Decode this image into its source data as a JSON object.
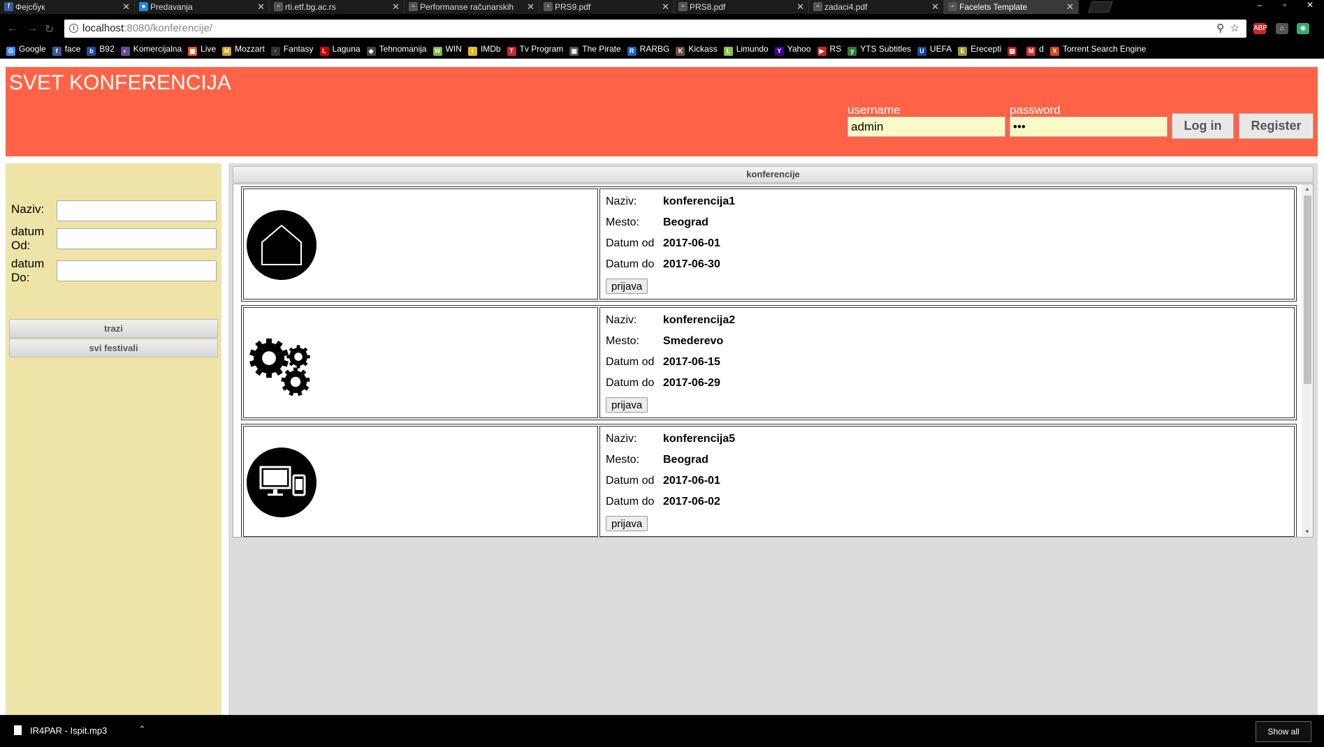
{
  "browser": {
    "tabs": [
      {
        "title": "Фејсбук",
        "icon": "facebook-icon",
        "color": "#3b5998",
        "glyph": "f"
      },
      {
        "title": "Predavanja",
        "icon": "edge-icon",
        "color": "#1e88e5",
        "glyph": "●"
      },
      {
        "title": "rti.etf.bg.ac.rs",
        "icon": "page-icon",
        "color": "#555555",
        "glyph": "▫"
      },
      {
        "title": "Performanse računarskih",
        "icon": "page-icon",
        "color": "#555555",
        "glyph": "▫"
      },
      {
        "title": "PRS9.pdf",
        "icon": "page-icon",
        "color": "#555555",
        "glyph": "▫"
      },
      {
        "title": "PRS8.pdf",
        "icon": "page-icon",
        "color": "#555555",
        "glyph": "▫"
      },
      {
        "title": "zadaci4.pdf",
        "icon": "page-icon",
        "color": "#555555",
        "glyph": "▫"
      },
      {
        "title": "Facelets Template",
        "icon": "page-icon",
        "color": "#555555",
        "glyph": "▫",
        "active": true
      }
    ],
    "url": {
      "host": "localhost",
      "path": ":8080/konferencije/"
    },
    "bookmarks": [
      {
        "label": "Google",
        "color": "#4285f4",
        "glyph": "G"
      },
      {
        "label": "face",
        "color": "#3b5998",
        "glyph": "f"
      },
      {
        "label": "B92",
        "color": "#1d4fa0",
        "glyph": "b"
      },
      {
        "label": "Komercijalna",
        "color": "#6a4c9c",
        "glyph": "◐"
      },
      {
        "label": "Live",
        "color": "#f25022",
        "glyph": "▦"
      },
      {
        "label": "Mozzart",
        "color": "#d4a017",
        "glyph": "M"
      },
      {
        "label": "Fantasy",
        "color": "#333333",
        "glyph": "·"
      },
      {
        "label": "Laguna",
        "color": "#cc0000",
        "glyph": "L"
      },
      {
        "label": "Tehnomanija",
        "color": "#444444",
        "glyph": "◆"
      },
      {
        "label": "WIN",
        "color": "#7cb342",
        "glyph": "W"
      },
      {
        "label": "IMDb",
        "color": "#e6b91e",
        "glyph": "i"
      },
      {
        "label": "Tv Program",
        "color": "#c62828",
        "glyph": "T"
      },
      {
        "label": "The Pirate",
        "color": "#555555",
        "glyph": "▣"
      },
      {
        "label": "RARBG",
        "color": "#1565c0",
        "glyph": "R"
      },
      {
        "label": "Kickass",
        "color": "#6d4c41",
        "glyph": "K"
      },
      {
        "label": "Limundo",
        "color": "#8bc34a",
        "glyph": "L"
      },
      {
        "label": "Yahoo",
        "color": "#400090",
        "glyph": "Y"
      },
      {
        "label": "RS",
        "color": "#c62828",
        "glyph": "▶"
      },
      {
        "label": "YTS Subtitles",
        "color": "#2e7d32",
        "glyph": "y"
      },
      {
        "label": "UEFA",
        "color": "#0d47a1",
        "glyph": "U"
      },
      {
        "label": "Erecepti",
        "color": "#9e9d24",
        "glyph": "E"
      },
      {
        "label": "",
        "color": "#b71c1c",
        "glyph": "▤"
      },
      {
        "label": "d",
        "color": "#d32f2f",
        "glyph": "M"
      },
      {
        "label": "Torrent Search Engine",
        "color": "#d84315",
        "glyph": "X"
      }
    ]
  },
  "site": {
    "title": "SVET KONFERENCIJA",
    "login": {
      "username_label": "username",
      "password_label": "password",
      "username_value": "admin",
      "password_value": "•••",
      "login_button": "Log in",
      "register_button": "Register"
    },
    "search": {
      "naziv_label": "Naziv:",
      "datum_od_label_1": "datum",
      "datum_od_label_2": "Od:",
      "datum_do_label_1": "datum",
      "datum_do_label_2": "Do:",
      "search_button": "trazi",
      "all_button": "svi festivali"
    },
    "panel_title": "konferencije",
    "field_labels": {
      "naziv": "Naziv:",
      "mesto": "Mesto:",
      "datum_od": "Datum od",
      "datum_do": "Datum do"
    },
    "conferences": [
      {
        "naziv": "konferencija1",
        "mesto": "Beograd",
        "datum_od": "2017-06-01",
        "datum_do": "2017-06-30",
        "icon": "house-icon",
        "button": "prijava"
      },
      {
        "naziv": "konferencija2",
        "mesto": "Smederevo",
        "datum_od": "2017-06-15",
        "datum_do": "2017-06-29",
        "icon": "gears-icon",
        "button": "prijava"
      },
      {
        "naziv": "konferencija5",
        "mesto": "Beograd",
        "datum_od": "2017-06-01",
        "datum_do": "2017-06-02",
        "icon": "devices-icon",
        "button": "prijava"
      }
    ]
  },
  "taskbar": {
    "download_file": "IR4PAR - Ispit.mp3",
    "show_all": "Show all"
  },
  "colors": {
    "header": "#ff6347",
    "sidebar": "#eee4a8",
    "input_fill": "#fafac8"
  }
}
